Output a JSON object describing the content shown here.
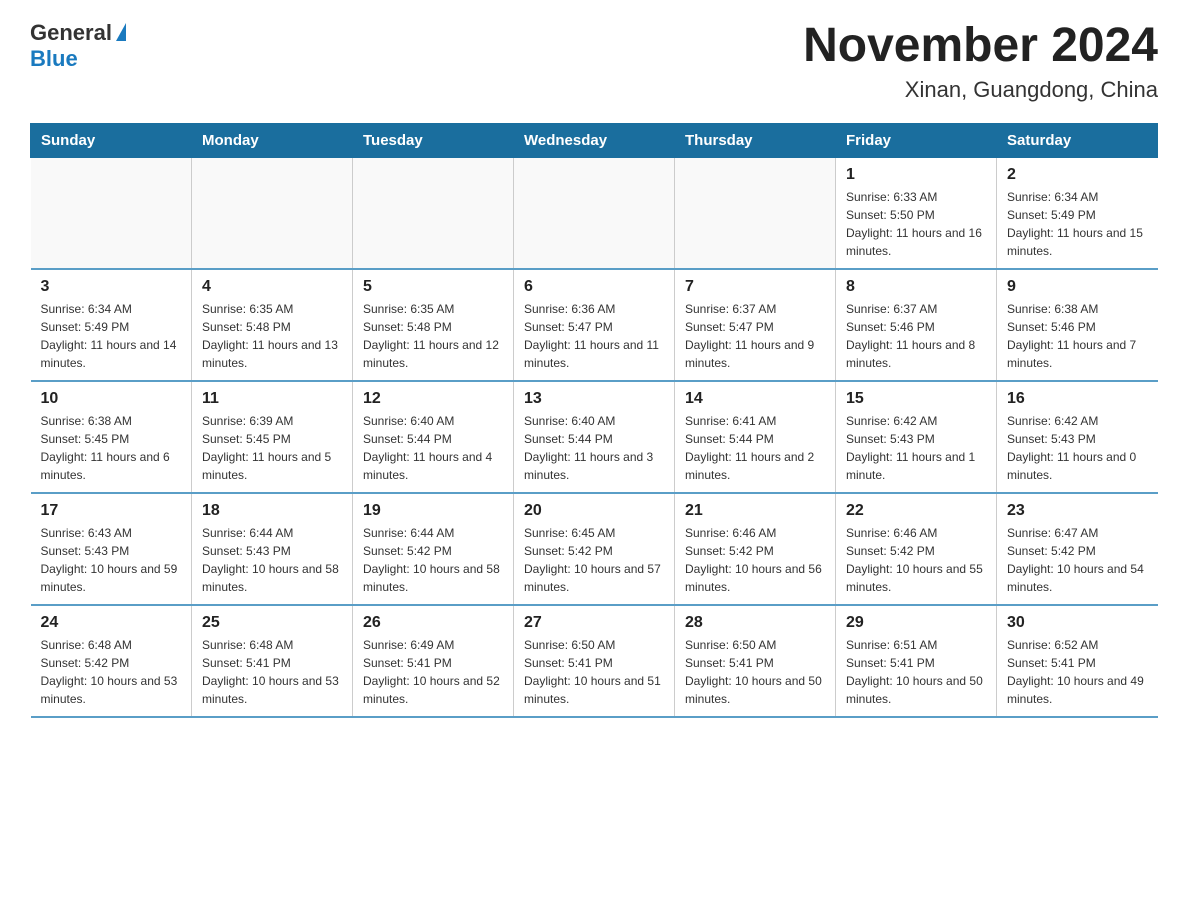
{
  "logo": {
    "general": "General",
    "blue": "Blue"
  },
  "header": {
    "month": "November 2024",
    "location": "Xinan, Guangdong, China"
  },
  "days_of_week": [
    "Sunday",
    "Monday",
    "Tuesday",
    "Wednesday",
    "Thursday",
    "Friday",
    "Saturday"
  ],
  "weeks": [
    [
      {
        "day": "",
        "info": ""
      },
      {
        "day": "",
        "info": ""
      },
      {
        "day": "",
        "info": ""
      },
      {
        "day": "",
        "info": ""
      },
      {
        "day": "",
        "info": ""
      },
      {
        "day": "1",
        "info": "Sunrise: 6:33 AM\nSunset: 5:50 PM\nDaylight: 11 hours and 16 minutes."
      },
      {
        "day": "2",
        "info": "Sunrise: 6:34 AM\nSunset: 5:49 PM\nDaylight: 11 hours and 15 minutes."
      }
    ],
    [
      {
        "day": "3",
        "info": "Sunrise: 6:34 AM\nSunset: 5:49 PM\nDaylight: 11 hours and 14 minutes."
      },
      {
        "day": "4",
        "info": "Sunrise: 6:35 AM\nSunset: 5:48 PM\nDaylight: 11 hours and 13 minutes."
      },
      {
        "day": "5",
        "info": "Sunrise: 6:35 AM\nSunset: 5:48 PM\nDaylight: 11 hours and 12 minutes."
      },
      {
        "day": "6",
        "info": "Sunrise: 6:36 AM\nSunset: 5:47 PM\nDaylight: 11 hours and 11 minutes."
      },
      {
        "day": "7",
        "info": "Sunrise: 6:37 AM\nSunset: 5:47 PM\nDaylight: 11 hours and 9 minutes."
      },
      {
        "day": "8",
        "info": "Sunrise: 6:37 AM\nSunset: 5:46 PM\nDaylight: 11 hours and 8 minutes."
      },
      {
        "day": "9",
        "info": "Sunrise: 6:38 AM\nSunset: 5:46 PM\nDaylight: 11 hours and 7 minutes."
      }
    ],
    [
      {
        "day": "10",
        "info": "Sunrise: 6:38 AM\nSunset: 5:45 PM\nDaylight: 11 hours and 6 minutes."
      },
      {
        "day": "11",
        "info": "Sunrise: 6:39 AM\nSunset: 5:45 PM\nDaylight: 11 hours and 5 minutes."
      },
      {
        "day": "12",
        "info": "Sunrise: 6:40 AM\nSunset: 5:44 PM\nDaylight: 11 hours and 4 minutes."
      },
      {
        "day": "13",
        "info": "Sunrise: 6:40 AM\nSunset: 5:44 PM\nDaylight: 11 hours and 3 minutes."
      },
      {
        "day": "14",
        "info": "Sunrise: 6:41 AM\nSunset: 5:44 PM\nDaylight: 11 hours and 2 minutes."
      },
      {
        "day": "15",
        "info": "Sunrise: 6:42 AM\nSunset: 5:43 PM\nDaylight: 11 hours and 1 minute."
      },
      {
        "day": "16",
        "info": "Sunrise: 6:42 AM\nSunset: 5:43 PM\nDaylight: 11 hours and 0 minutes."
      }
    ],
    [
      {
        "day": "17",
        "info": "Sunrise: 6:43 AM\nSunset: 5:43 PM\nDaylight: 10 hours and 59 minutes."
      },
      {
        "day": "18",
        "info": "Sunrise: 6:44 AM\nSunset: 5:43 PM\nDaylight: 10 hours and 58 minutes."
      },
      {
        "day": "19",
        "info": "Sunrise: 6:44 AM\nSunset: 5:42 PM\nDaylight: 10 hours and 58 minutes."
      },
      {
        "day": "20",
        "info": "Sunrise: 6:45 AM\nSunset: 5:42 PM\nDaylight: 10 hours and 57 minutes."
      },
      {
        "day": "21",
        "info": "Sunrise: 6:46 AM\nSunset: 5:42 PM\nDaylight: 10 hours and 56 minutes."
      },
      {
        "day": "22",
        "info": "Sunrise: 6:46 AM\nSunset: 5:42 PM\nDaylight: 10 hours and 55 minutes."
      },
      {
        "day": "23",
        "info": "Sunrise: 6:47 AM\nSunset: 5:42 PM\nDaylight: 10 hours and 54 minutes."
      }
    ],
    [
      {
        "day": "24",
        "info": "Sunrise: 6:48 AM\nSunset: 5:42 PM\nDaylight: 10 hours and 53 minutes."
      },
      {
        "day": "25",
        "info": "Sunrise: 6:48 AM\nSunset: 5:41 PM\nDaylight: 10 hours and 53 minutes."
      },
      {
        "day": "26",
        "info": "Sunrise: 6:49 AM\nSunset: 5:41 PM\nDaylight: 10 hours and 52 minutes."
      },
      {
        "day": "27",
        "info": "Sunrise: 6:50 AM\nSunset: 5:41 PM\nDaylight: 10 hours and 51 minutes."
      },
      {
        "day": "28",
        "info": "Sunrise: 6:50 AM\nSunset: 5:41 PM\nDaylight: 10 hours and 50 minutes."
      },
      {
        "day": "29",
        "info": "Sunrise: 6:51 AM\nSunset: 5:41 PM\nDaylight: 10 hours and 50 minutes."
      },
      {
        "day": "30",
        "info": "Sunrise: 6:52 AM\nSunset: 5:41 PM\nDaylight: 10 hours and 49 minutes."
      }
    ]
  ]
}
